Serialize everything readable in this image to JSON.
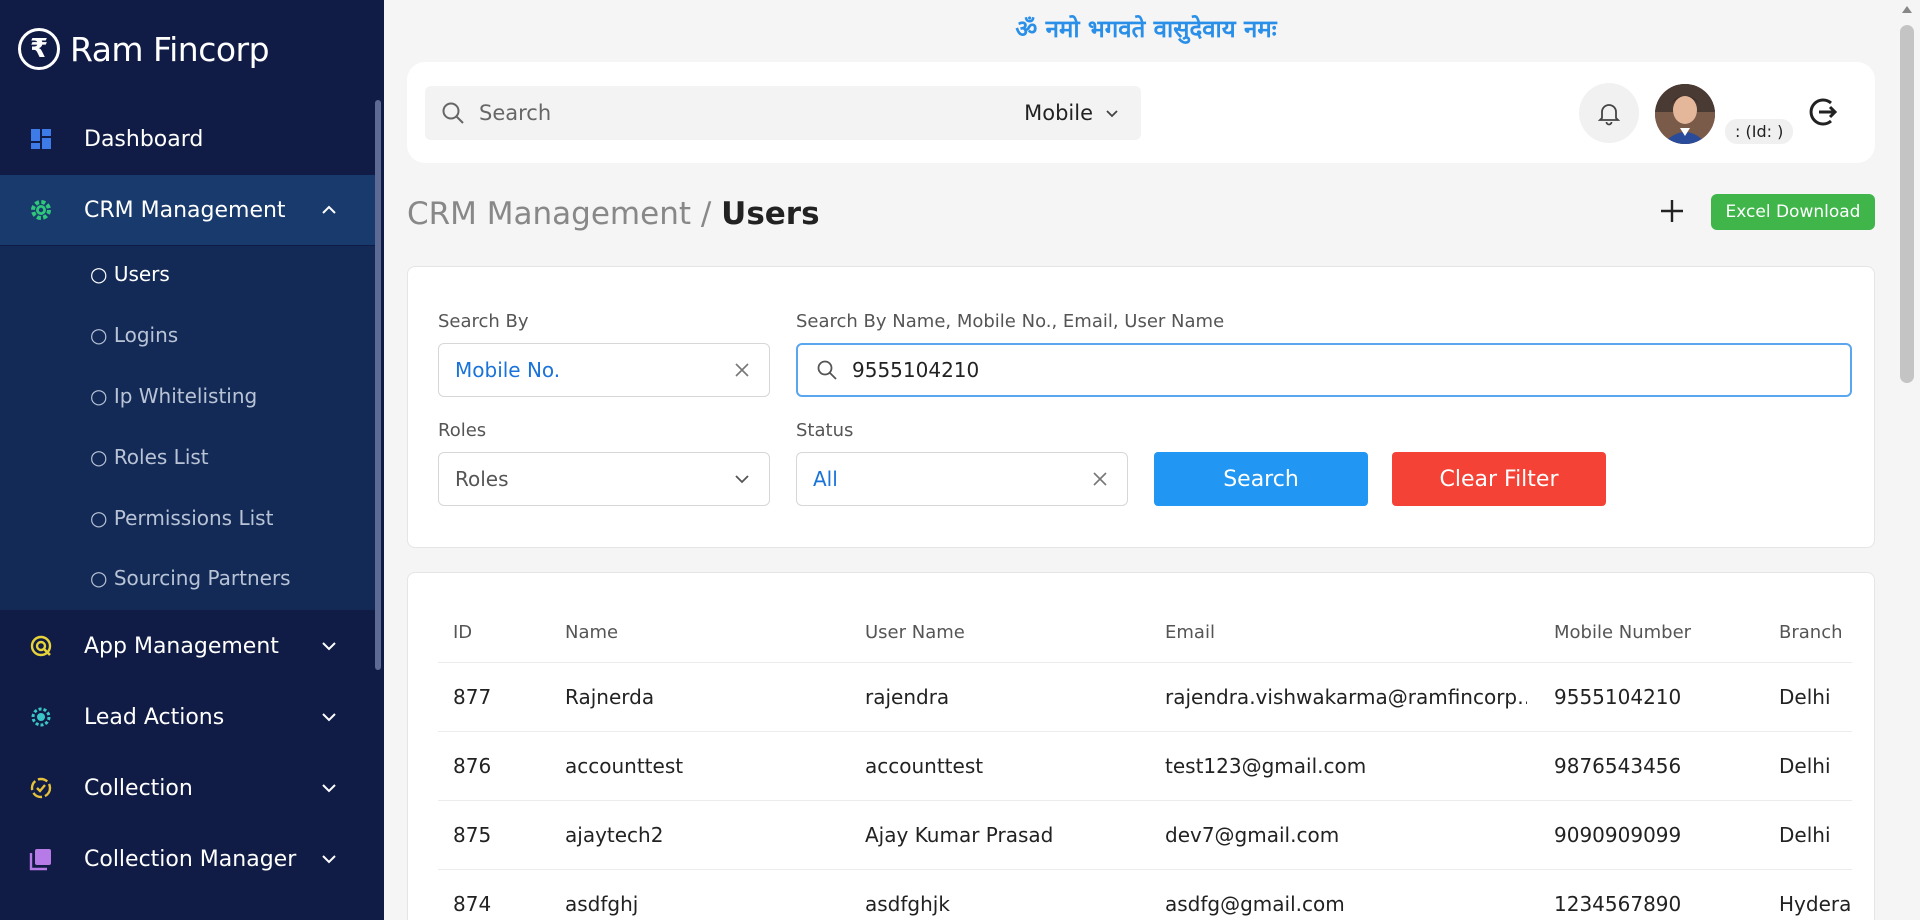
{
  "brand": {
    "symbol": "₹",
    "name": "Ram Fincorp"
  },
  "sidebar": {
    "items": [
      {
        "label": "Dashboard",
        "icon": "dashboard-icon",
        "color": "#3d7be8"
      },
      {
        "label": "CRM Management",
        "icon": "gear-icon",
        "color": "#2fc77a",
        "expanded": true
      },
      {
        "label": "App Management",
        "icon": "app-icon",
        "color": "#e6d23a"
      },
      {
        "label": "Lead Actions",
        "icon": "lead-icon",
        "color": "#3ac7c7"
      },
      {
        "label": "Collection",
        "icon": "collection-icon",
        "color": "#e6c23a"
      },
      {
        "label": "Collection Manager",
        "icon": "collection-manager-icon",
        "color": "#b77be8"
      }
    ],
    "submenu": [
      "Users",
      "Logins",
      "Ip Whitelisting",
      "Roles List",
      "Permissions List",
      "Sourcing Partners"
    ],
    "submenu_bullet": "○"
  },
  "header": {
    "mantra": "ॐ नमो भगवते वासुदेवाय नमः",
    "search_placeholder": "Search",
    "search_type": "Mobile",
    "id_badge": ": (Id: )"
  },
  "breadcrumb": {
    "parent": "CRM Management",
    "separator": " / ",
    "current": "Users"
  },
  "actions": {
    "excel_label": "Excel Download"
  },
  "filters": {
    "search_by_label": "Search By",
    "search_by_value": "Mobile No.",
    "query_label": "Search By Name, Mobile No., Email, User Name",
    "query_value": "9555104210",
    "roles_label": "Roles",
    "roles_value": "Roles",
    "status_label": "Status",
    "status_value": "All",
    "search_button": "Search",
    "clear_button": "Clear Filter"
  },
  "table": {
    "columns": [
      "ID",
      "Name",
      "User Name",
      "Email",
      "Mobile Number",
      "Branch"
    ],
    "rows": [
      [
        "877",
        "Rajnerda",
        "rajendra",
        "rajendra.vishwakarma@ramfincorp…",
        "9555104210",
        "Delhi"
      ],
      [
        "876",
        "accounttest",
        "accounttest",
        "test123@gmail.com",
        "9876543456",
        "Delhi"
      ],
      [
        "875",
        "ajaytech2",
        "Ajay Kumar Prasad",
        "dev7@gmail.com",
        "9090909099",
        "Delhi"
      ],
      [
        "874",
        "asdfghj",
        "asdfghjk",
        "asdfg@gmail.com",
        "1234567890",
        "Hyderabad"
      ]
    ]
  },
  "colors": {
    "sidebar_bg": "#101c45",
    "active_bg": "#183a6c",
    "accent_blue": "#2196f3",
    "danger_red": "#f44336",
    "success_green": "#3fb54a"
  }
}
